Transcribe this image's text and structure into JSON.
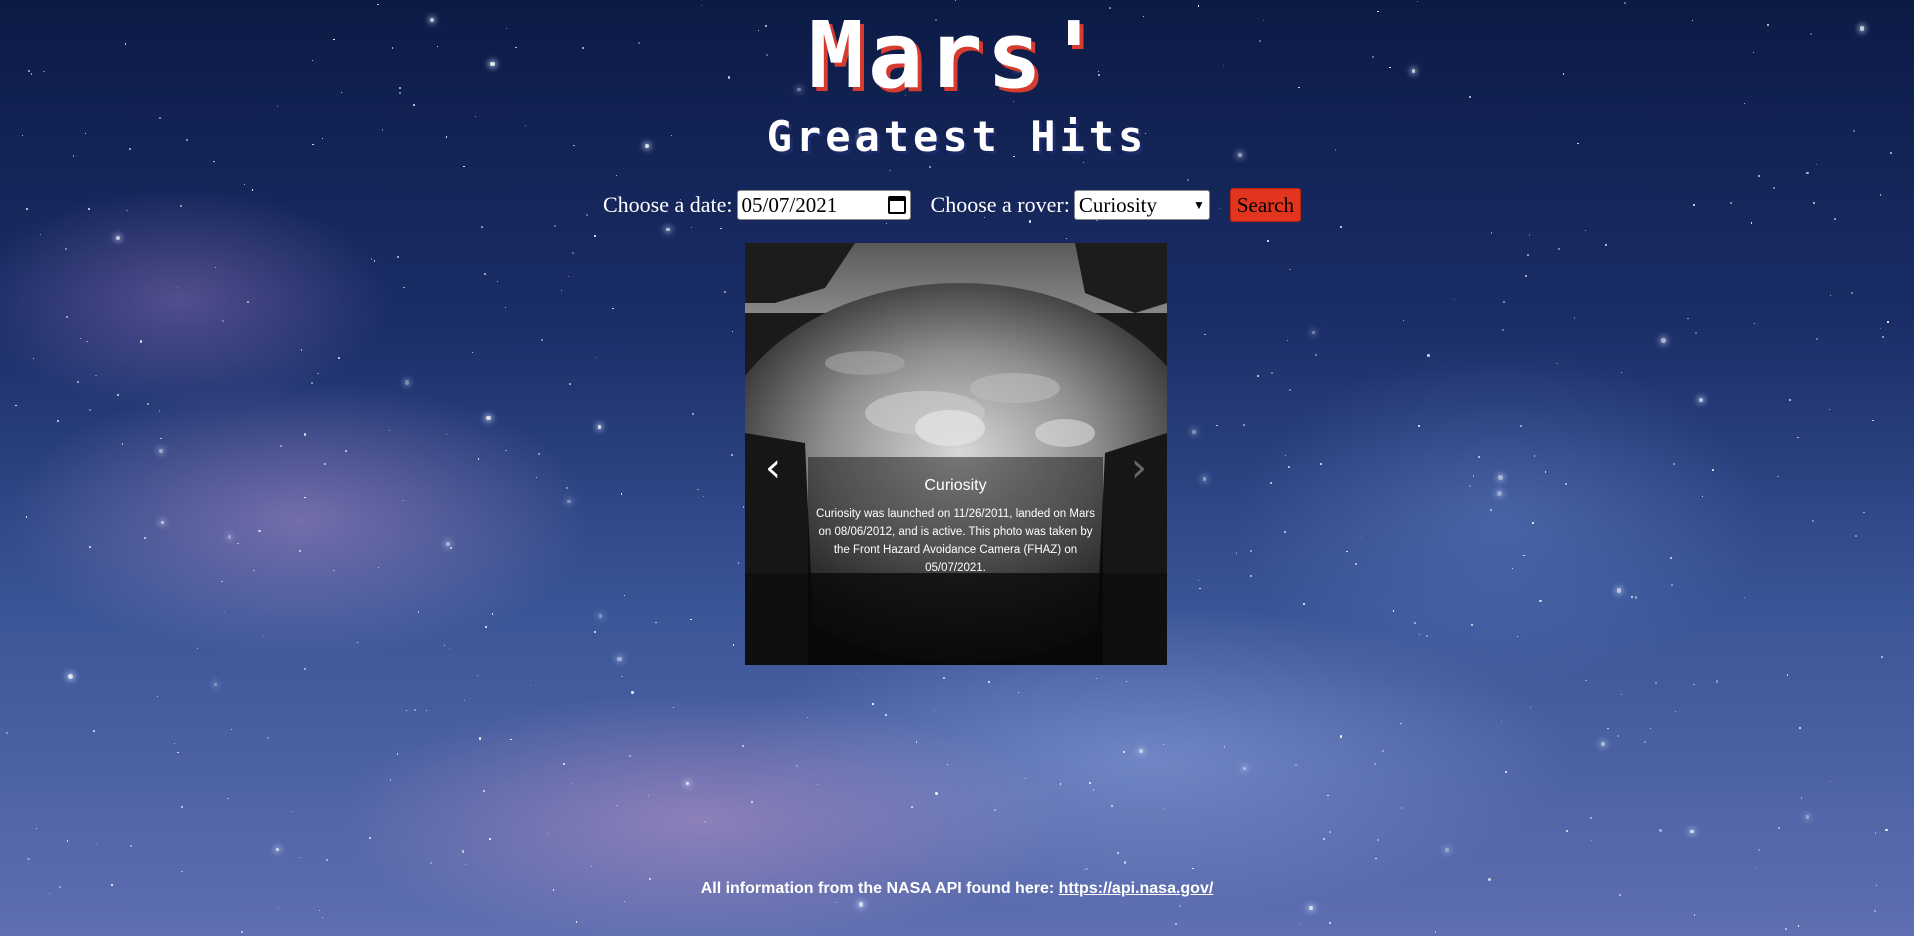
{
  "header": {
    "title": "Mars'",
    "subtitle": "Greatest Hits"
  },
  "form": {
    "date_label": "Choose a date:",
    "date_value": "05/07/2021",
    "rover_label": "Choose a rover:",
    "rover_value": "Curiosity",
    "search_label": "Search"
  },
  "carousel": {
    "title": "Curiosity",
    "description": "Curiosity was launched on 11/26/2011, landed on Mars on 08/06/2012, and is active. This photo was taken by the Front Hazard Avoidance Camera (FHAZ) on 05/07/2021.",
    "prev_glyph": "‹",
    "next_glyph": "›"
  },
  "footer": {
    "text": "All information from the NASA API found here: ",
    "link": "https://api.nasa.gov/"
  },
  "colors": {
    "accent": "#e3341e",
    "title_shadow": "#d63b2f"
  }
}
